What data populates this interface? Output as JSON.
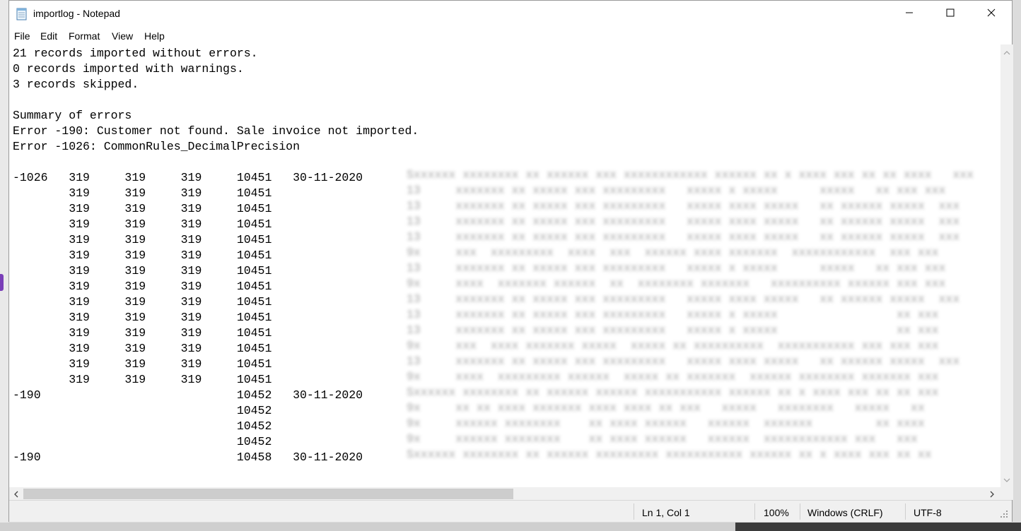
{
  "window": {
    "title": "importlog - Notepad"
  },
  "menu": [
    "File",
    "Edit",
    "Format",
    "View",
    "Help"
  ],
  "editor": {
    "lines": [
      "21 records imported without errors.",
      "0 records imported with warnings.",
      "3 records skipped.",
      "",
      "Summary of errors",
      "Error -190: Customer not found. Sale invoice not imported.",
      "Error -1026: CommonRules_DecimalPrecision",
      "",
      "-1026   319     319     319     10451   30-11-2020",
      "        319     319     319     10451",
      "        319     319     319     10451",
      "        319     319     319     10451",
      "        319     319     319     10451",
      "        319     319     319     10451",
      "        319     319     319     10451",
      "        319     319     319     10451",
      "        319     319     319     10451",
      "        319     319     319     10451",
      "        319     319     319     10451",
      "        319     319     319     10451",
      "        319     319     319     10451",
      "        319     319     319     10451",
      "-190                            10452   30-11-2020",
      "                                10452",
      "                                10452",
      "                                10452",
      "-190                            10458   30-11-2020"
    ]
  },
  "statusbar": {
    "position": "Ln 1, Col 1",
    "zoom": "100%",
    "line_ending": "Windows (CRLF)",
    "encoding": "UTF-8"
  },
  "icons": {
    "app": "notepad-icon",
    "minimize": "minimize-icon",
    "maximize": "maximize-icon",
    "close": "close-icon"
  }
}
